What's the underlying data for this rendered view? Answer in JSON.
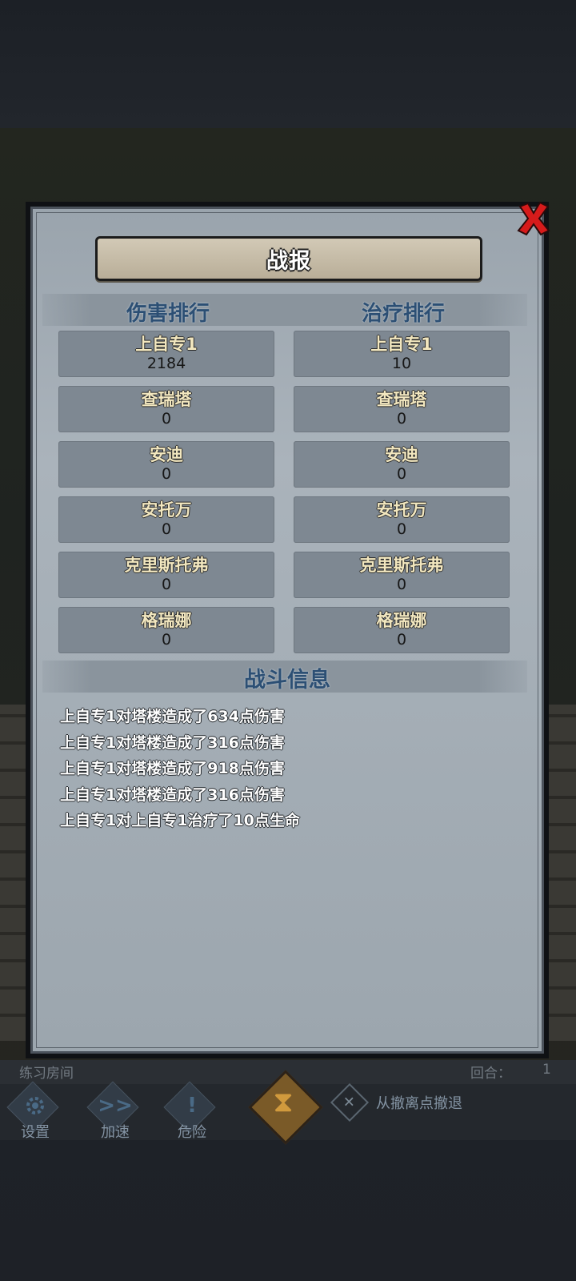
{
  "modal": {
    "title": "战报",
    "damage_header": "伤害排行",
    "heal_header": "治疗排行",
    "damage_rank": [
      {
        "name": "上自专1",
        "value": "2184"
      },
      {
        "name": "查瑞塔",
        "value": "0"
      },
      {
        "name": "安迪",
        "value": "0"
      },
      {
        "name": "安托万",
        "value": "0"
      },
      {
        "name": "克里斯托弗",
        "value": "0"
      },
      {
        "name": "格瑞娜",
        "value": "0"
      }
    ],
    "heal_rank": [
      {
        "name": "上自专1",
        "value": "10"
      },
      {
        "name": "查瑞塔",
        "value": "0"
      },
      {
        "name": "安迪",
        "value": "0"
      },
      {
        "name": "安托万",
        "value": "0"
      },
      {
        "name": "克里斯托弗",
        "value": "0"
      },
      {
        "name": "格瑞娜",
        "value": "0"
      }
    ],
    "log_header": "战斗信息",
    "log": [
      "上自专1对塔楼造成了634点伤害",
      "上自专1对塔楼造成了316点伤害",
      "上自专1对塔楼造成了918点伤害",
      "上自专1对塔楼造成了316点伤害",
      "上自专1对上自专1治疗了10点生命"
    ],
    "close_icon": "close-x-icon",
    "close_color": "#d61b1b"
  },
  "status": {
    "room": "练习房间",
    "turn_label": "回合：",
    "turn_value": "1"
  },
  "toolbar": {
    "settings": "设置",
    "speed": "加速",
    "danger": "危险",
    "speed_icon": ">>",
    "danger_icon": "!",
    "retreat": "从撤离点撤退"
  }
}
